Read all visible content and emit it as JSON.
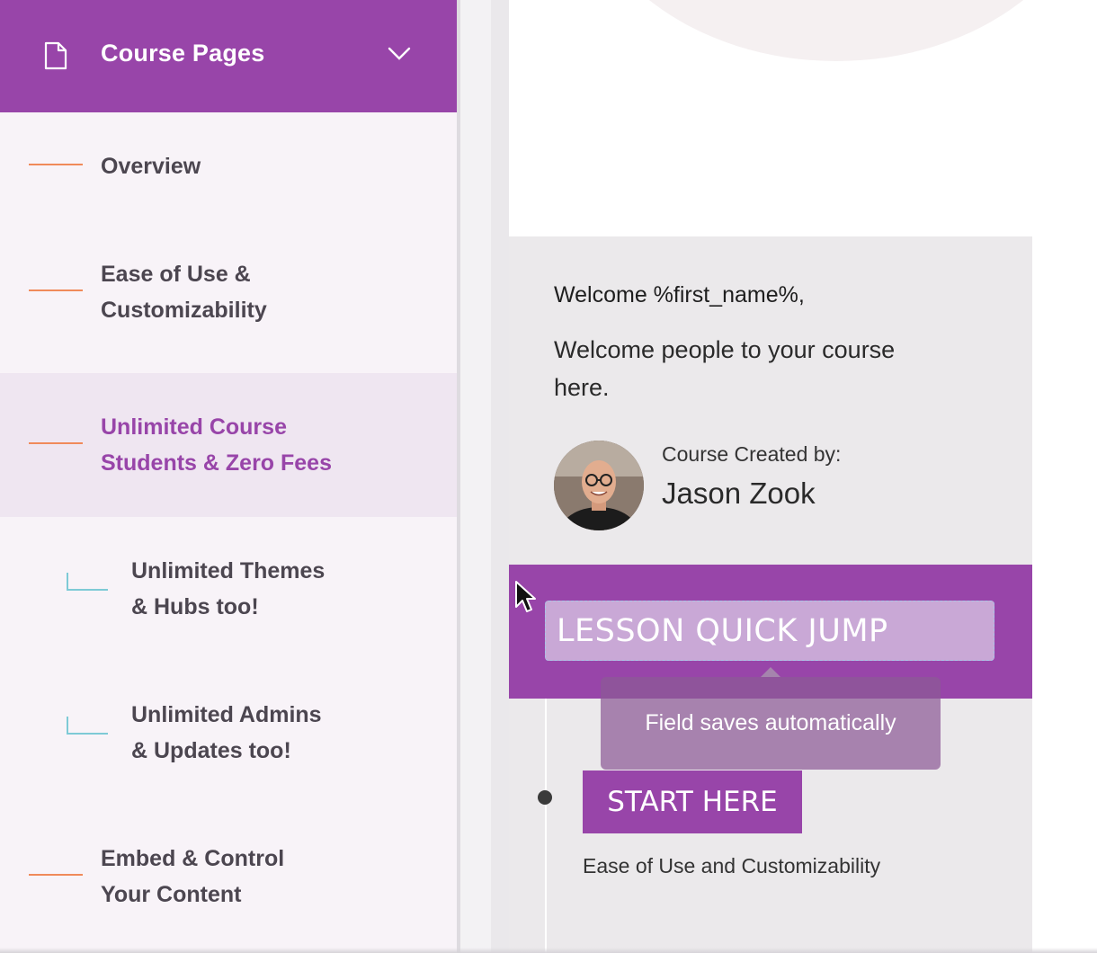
{
  "sidebar": {
    "header_title": "Course Pages",
    "items": [
      {
        "label_line1": "Overview",
        "label_line2": "",
        "type": "main",
        "active": false
      },
      {
        "label_line1": "Ease of Use &",
        "label_line2": "Customizability",
        "type": "main",
        "active": false
      },
      {
        "label_line1": "Unlimited Course",
        "label_line2": "Students & Zero Fees",
        "type": "main",
        "active": true
      },
      {
        "label_line1": "Unlimited Themes",
        "label_line2": "& Hubs too!",
        "type": "sub",
        "active": false
      },
      {
        "label_line1": "Unlimited Admins",
        "label_line2": "& Updates too!",
        "type": "sub",
        "active": false
      },
      {
        "label_line1": "Embed & Control",
        "label_line2": "Your Content",
        "type": "main",
        "active": false
      }
    ]
  },
  "main": {
    "welcome_line": "Welcome %first_name%,",
    "welcome_body": "Welcome people to your course here.",
    "creator_label": "Course Created by:",
    "creator_name": "Jason Zook",
    "quick_jump_value": "LESSON QUICK JUMP",
    "tooltip": "Field saves automatically",
    "start_button": "START HERE",
    "start_caption": "Ease of Use and Customizability"
  },
  "colors": {
    "accent": "#9845a9",
    "sidebar_bg": "#f8f3f8",
    "active_item_bg": "#efe6f1",
    "dash_orange": "#f08a5a",
    "elbow_teal": "#7ecad6",
    "panel_bg": "#ebe9eb"
  },
  "icons": {
    "header": "document-icon",
    "toggle": "chevron-down-icon",
    "pointer": "cursor-arrow-icon"
  }
}
